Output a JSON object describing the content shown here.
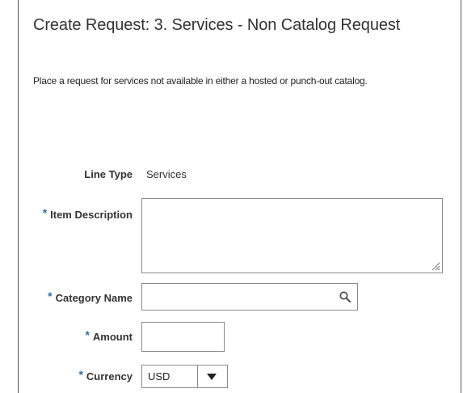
{
  "page": {
    "title": "Create Request: 3. Services - Non Catalog Request",
    "description": "Place a request for services not available in either a hosted or punch-out catalog."
  },
  "form": {
    "required_marker": "*",
    "line_type": {
      "label": "Line Type",
      "value": "Services"
    },
    "item_description": {
      "label": "Item Description",
      "value": ""
    },
    "category_name": {
      "label": "Category Name",
      "value": ""
    },
    "amount": {
      "label": "Amount",
      "value": ""
    },
    "currency": {
      "label": "Currency",
      "value": "USD"
    }
  },
  "icons": {
    "search": "search-icon",
    "dropdown": "caret-down-icon",
    "resize": "resize-grip-icon"
  },
  "colors": {
    "required_asterisk": "#2b6dad",
    "text": "#333333",
    "border": "#8a8a8a"
  }
}
